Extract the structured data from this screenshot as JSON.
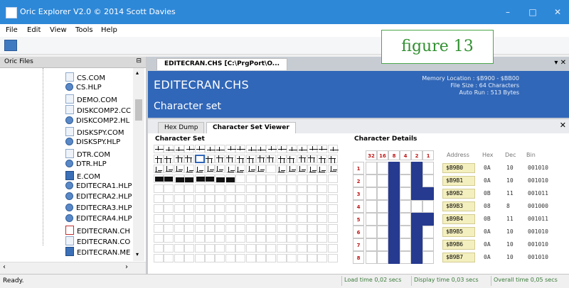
{
  "window": {
    "title": "Oric Explorer V2.0 © 2014 Scott Davies",
    "controls": [
      "–",
      "□",
      "✕"
    ]
  },
  "menu": [
    "File",
    "Edit",
    "View",
    "Tools",
    "Help"
  ],
  "left_panel": {
    "title": "Oric Files",
    "pin": "⊟",
    "files": [
      {
        "name": "CS.COM",
        "icon": "file-icon"
      },
      {
        "name": "CS.HLP",
        "icon": "help-icon"
      },
      {
        "name": "DEMO.COM",
        "icon": "file-icon"
      },
      {
        "name": "DISKCOMP2.CC",
        "icon": "file-icon"
      },
      {
        "name": "DISKCOMP2.HL",
        "icon": "help-icon"
      },
      {
        "name": "DISKSPY.COM",
        "icon": "file-icon"
      },
      {
        "name": "DISKSPY.HLP",
        "icon": "help-icon"
      },
      {
        "name": "DTR.COM",
        "icon": "file-icon"
      },
      {
        "name": "DTR.HLP",
        "icon": "help-icon"
      },
      {
        "name": "E.COM",
        "icon": "image-icon"
      },
      {
        "name": "EDITECRA1.HLP",
        "icon": "help-icon"
      },
      {
        "name": "EDITECRA2.HLP",
        "icon": "help-icon"
      },
      {
        "name": "EDITECRA3.HLP",
        "icon": "help-icon"
      },
      {
        "name": "EDITECRA4.HLP",
        "icon": "help-icon"
      },
      {
        "name": "EDITECRAN.CH",
        "icon": "font-icon"
      },
      {
        "name": "EDITECRAN.CO",
        "icon": "file-icon"
      },
      {
        "name": "EDITECRAN.ME",
        "icon": "image-icon"
      }
    ]
  },
  "figure_label": "figure 13",
  "document": {
    "tab_label": "EDITECRAN.CHS [C:\\PrgPort\\O...",
    "banner_title": "EDITECRAN.CHS",
    "banner_subtitle": "Character set",
    "memory_location": "Memory Location : $B900 - $BB00",
    "file_size": "File Size : 64 Characters",
    "auto_run": "Auto Run : 513 Bytes",
    "tabs": [
      "Hex Dump",
      "Character Set Viewer"
    ],
    "active_tab": "Character Set Viewer",
    "char_set_label": "Character Set",
    "details_label": "Character Details"
  },
  "character_details": {
    "bit_headers": [
      "32",
      "16",
      "8",
      "4",
      "2",
      "1"
    ],
    "row_numbers": [
      "1",
      "2",
      "3",
      "4",
      "5",
      "6",
      "7",
      "8"
    ],
    "bits": [
      [
        0,
        0,
        1,
        0,
        1,
        0
      ],
      [
        0,
        0,
        1,
        0,
        1,
        0
      ],
      [
        0,
        0,
        1,
        0,
        1,
        1
      ],
      [
        0,
        0,
        1,
        0,
        0,
        0
      ],
      [
        0,
        0,
        1,
        0,
        1,
        1
      ],
      [
        0,
        0,
        1,
        0,
        1,
        0
      ],
      [
        0,
        0,
        1,
        0,
        1,
        0
      ],
      [
        0,
        0,
        1,
        0,
        1,
        0
      ]
    ],
    "column_headers": [
      "Address",
      "Hex",
      "Dec",
      "Bin"
    ],
    "rows": [
      {
        "address": "$B9B0",
        "hex": "0A",
        "dec": "10",
        "bin": "001010"
      },
      {
        "address": "$B9B1",
        "hex": "0A",
        "dec": "10",
        "bin": "001010"
      },
      {
        "address": "$B9B2",
        "hex": "0B",
        "dec": "11",
        "bin": "001011"
      },
      {
        "address": "$B9B3",
        "hex": "08",
        "dec": "8",
        "bin": "001000"
      },
      {
        "address": "$B9B4",
        "hex": "0B",
        "dec": "11",
        "bin": "001011"
      },
      {
        "address": "$B9B5",
        "hex": "0A",
        "dec": "10",
        "bin": "001010"
      },
      {
        "address": "$B9B6",
        "hex": "0A",
        "dec": "10",
        "bin": "001010"
      },
      {
        "address": "$B9B7",
        "hex": "0A",
        "dec": "10",
        "bin": "001010"
      }
    ]
  },
  "status": {
    "ready": "Ready.",
    "load_time": "Load time 0,02 secs",
    "display_time": "Display time 0,03 secs",
    "overall_time": "Overall time 0,05 secs"
  },
  "colors": {
    "titlebar": "#2e88d8",
    "banner": "#3167b8",
    "bit_on": "#263a90",
    "bit_header": "#c01818",
    "address_bg": "#f4efbe",
    "status_text": "#3a7a3a",
    "figure_label": "#2f8f2f"
  }
}
